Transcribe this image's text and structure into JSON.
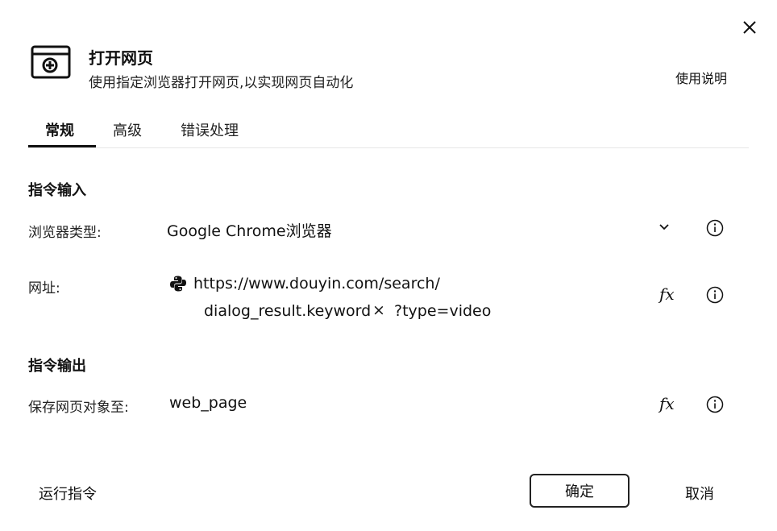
{
  "dialog": {
    "title": "打开网页",
    "subtitle": "使用指定浏览器打开网页,以实现网页自动化",
    "help_label": "使用说明"
  },
  "tabs": [
    {
      "label": "常规",
      "active": true
    },
    {
      "label": "高级",
      "active": false
    },
    {
      "label": "错误处理",
      "active": false
    }
  ],
  "input_section": {
    "heading": "指令输入",
    "browser_type": {
      "label": "浏览器类型:",
      "value": "Google Chrome浏览器"
    },
    "url": {
      "label": "网址:",
      "line1": "https://www.douyin.com/search/",
      "variable": "dialog_result.keyword",
      "remove_glyph": "×",
      "suffix": "?type=video"
    }
  },
  "output_section": {
    "heading": "指令输出",
    "save_to": {
      "label": "保存网页对象至:",
      "value": "web_page"
    }
  },
  "footer": {
    "run_label": "运行指令",
    "ok_label": "确定",
    "cancel_label": "取消"
  },
  "icons": {
    "close": "close-icon",
    "header": "browser-window-add-icon",
    "chevron": "chevron-down-icon",
    "info": "info-icon",
    "fx": "fx-icon",
    "python": "python-icon"
  },
  "fx_glyph": "fx"
}
